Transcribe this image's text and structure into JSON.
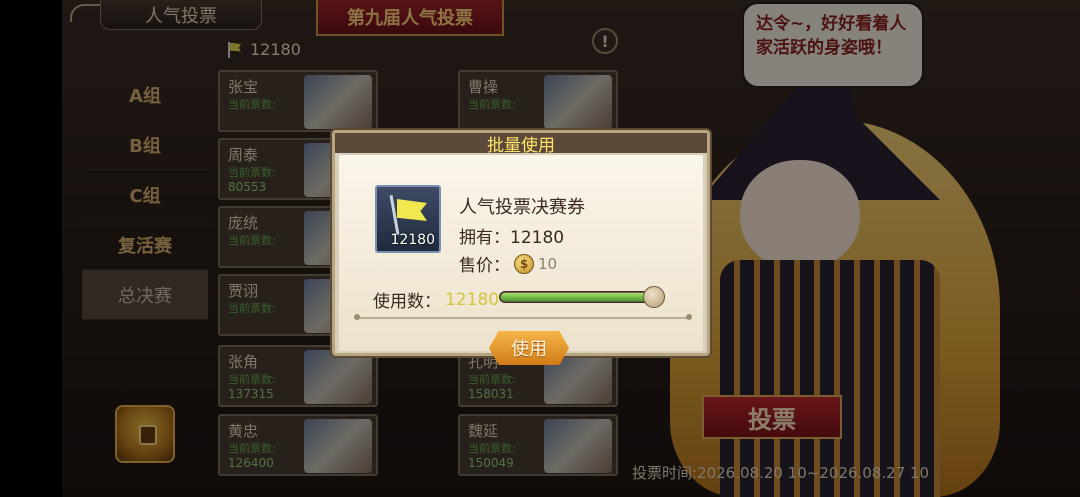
{
  "header": {
    "title": "人气投票",
    "event_banner": "第九届人气投票",
    "info_icon": "!",
    "ticket_count": "12180"
  },
  "side_nav": {
    "items": [
      {
        "label": "A组",
        "active": false
      },
      {
        "label": "B组",
        "active": false
      },
      {
        "label": "C组",
        "active": false
      },
      {
        "label": "复活赛",
        "active": false
      },
      {
        "label": "总决赛",
        "active": true
      }
    ]
  },
  "candidates": {
    "vote_label": "当前票数:",
    "left": [
      {
        "name": "张宝",
        "votes": ""
      },
      {
        "name": "周泰",
        "votes": "80553"
      },
      {
        "name": "庞统",
        "votes": ""
      },
      {
        "name": "贾诩",
        "votes": ""
      },
      {
        "name": "张角",
        "votes": "137315"
      },
      {
        "name": "黄忠",
        "votes": "126400"
      }
    ],
    "right": [
      {
        "name": "曹操",
        "votes": ""
      },
      {
        "name": "孔明",
        "votes": "158031"
      },
      {
        "name": "魏延",
        "votes": "150049"
      }
    ]
  },
  "character": {
    "speech": "达令~，好好看着人家活跃的身姿哦！"
  },
  "vote": {
    "button_label": "投票",
    "time_text": "投票时间:2026.08.20 10~2026.08.27 10"
  },
  "modal": {
    "title": "批量使用",
    "item_name": "人气投票决赛券",
    "item_icon_count": "12180",
    "owned_label": "拥有：",
    "owned_value": "12180",
    "price_label": "售价：",
    "price_coin": "$",
    "price_value": "10",
    "use_label": "使用数：",
    "use_value": "12180",
    "slider_fraction": 1.0,
    "use_button": "使用"
  },
  "colors": {
    "accent_gold": "#ffe56a",
    "vote_red": "#c0282d",
    "slider_green": "#4a9a2a"
  }
}
